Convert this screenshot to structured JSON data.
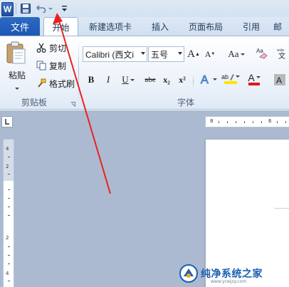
{
  "app": {
    "logo_letter": "W",
    "icon": "word-app-icon"
  },
  "quick_access": {
    "save_icon": "save-icon",
    "undo_icon": "undo-icon",
    "undo_dropdown_icon": "chevron-down-icon",
    "customize_icon": "customize-toolbar-icon"
  },
  "tabs": {
    "file": "文件",
    "items": [
      "开始",
      "新建选项卡",
      "插入",
      "页面布局",
      "引用",
      "邮"
    ],
    "active_index": 0
  },
  "clipboard": {
    "paste_label": "粘贴",
    "cut_label": "剪切",
    "copy_label": "复制",
    "format_painter_label": "格式刷",
    "group_label": "剪贴板"
  },
  "font": {
    "font_name": "Calibri (西文i",
    "font_size": "五号",
    "grow_label": "A",
    "shrink_label": "A",
    "change_case_label": "Aa",
    "bold_label": "B",
    "italic_label": "I",
    "underline_label": "U",
    "strike_label": "abe",
    "subscript_label": "x₂",
    "superscript_label": "x²",
    "highlight_label": "ab",
    "font_color_label": "A",
    "group_label": "字体"
  },
  "ruler": {
    "h_label_left": "8",
    "h_label_right": "6",
    "v_labels": [
      "4",
      "2",
      "2",
      "4"
    ]
  },
  "watermark": {
    "text": "纯净系统之家",
    "url": "www.ycwjzy.com"
  },
  "colors": {
    "file_tab": "#2a66bf",
    "arrow": "#e8231f",
    "highlight": "#ffe400",
    "font_color": "#e0161b"
  }
}
